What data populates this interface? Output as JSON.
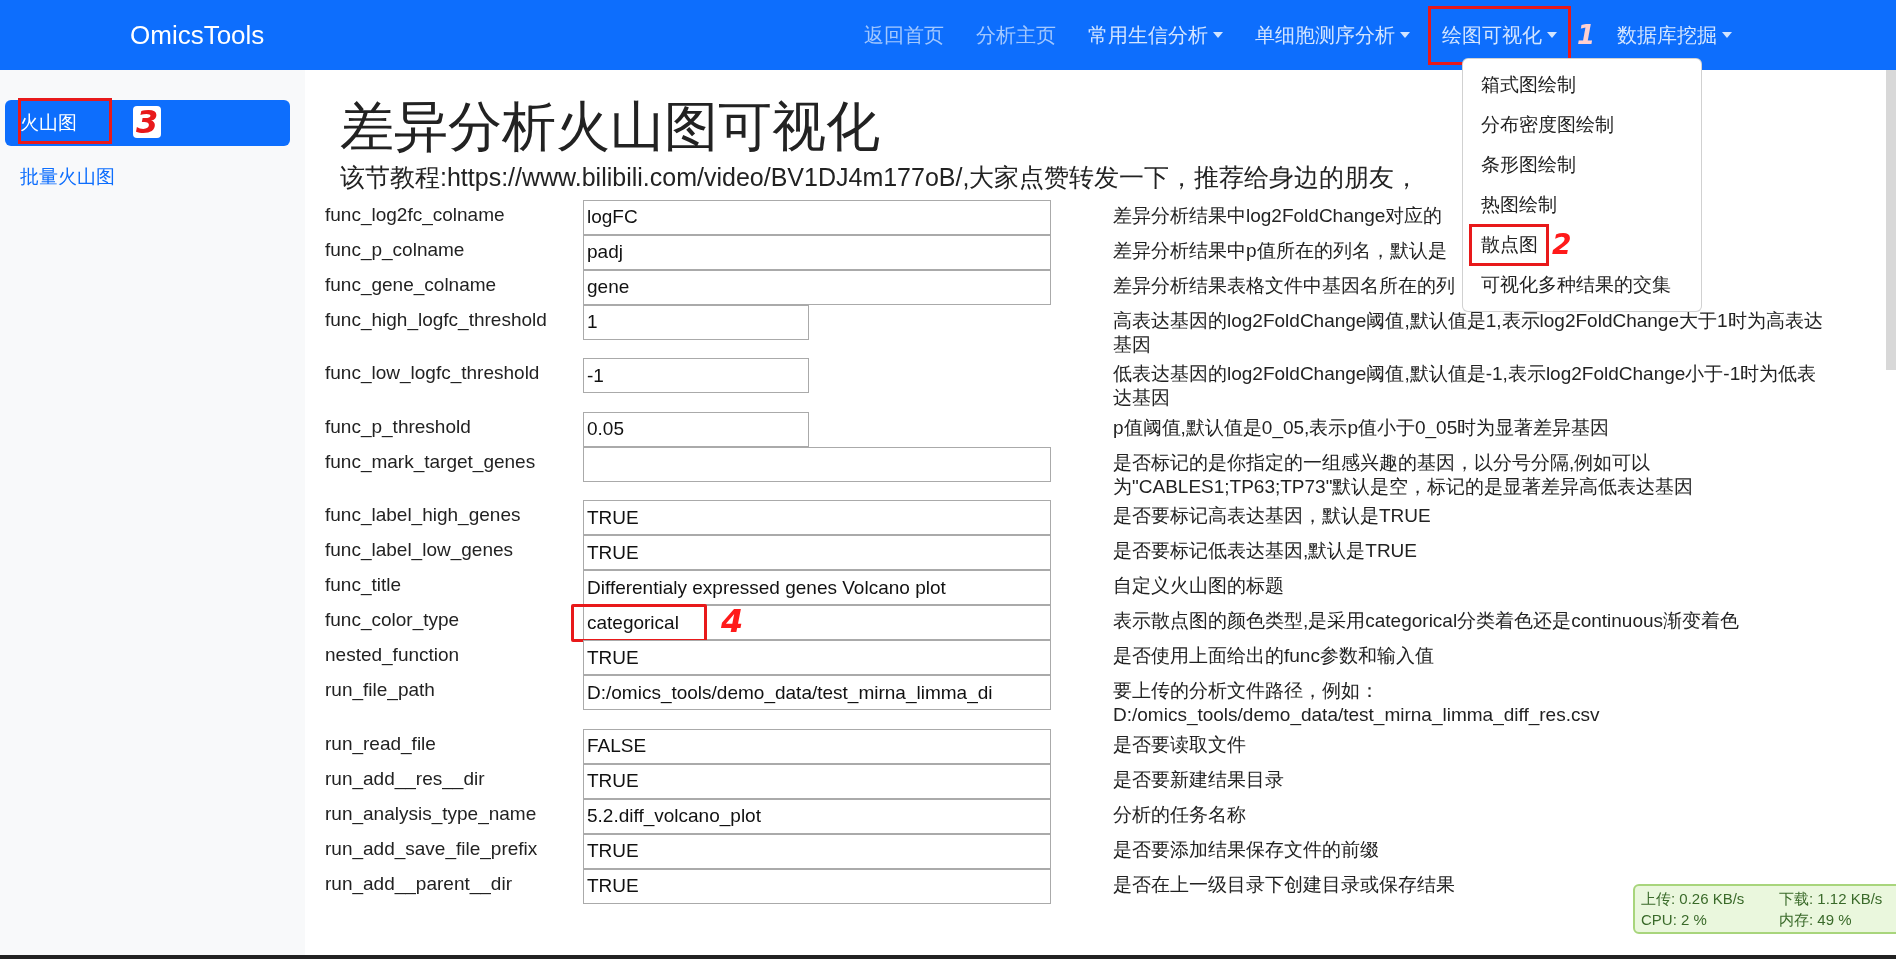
{
  "navbar": {
    "brand": "OmicsTools",
    "items": [
      {
        "label": "返回首页",
        "kind": "link"
      },
      {
        "label": "分析主页",
        "kind": "link"
      },
      {
        "label": "常用生信分析",
        "kind": "dropdown"
      },
      {
        "label": "单细胞测序分析",
        "kind": "dropdown"
      },
      {
        "label": "绘图可视化",
        "kind": "dropdown",
        "annotation": "1"
      },
      {
        "label": "数据库挖掘",
        "kind": "dropdown"
      }
    ]
  },
  "dropdown_menu": {
    "items": [
      {
        "label": "箱式图绘制"
      },
      {
        "label": "分布密度图绘制"
      },
      {
        "label": "条形图绘制"
      },
      {
        "label": "热图绘制"
      },
      {
        "label": "散点图",
        "annotation": "2"
      },
      {
        "label": "可视化多种结果的交集"
      }
    ]
  },
  "sidebar": {
    "items": [
      {
        "label": "火山图",
        "selected": true,
        "annotation": "3"
      },
      {
        "label": "批量火山图",
        "selected": false
      }
    ]
  },
  "page": {
    "title": "差异分析火山图可视化",
    "tutorial": "该节教程:https://www.bilibili.com/video/BV1DJ4m177oB/,大家点赞转发一下，推荐给身边的朋友，"
  },
  "form": {
    "rows": [
      {
        "label": "func_log2fc_colname",
        "value": "logFC",
        "kind": "long",
        "description": "差异分析结果中log2FoldChange对应的"
      },
      {
        "label": "func_p_colname",
        "value": "padj",
        "kind": "long",
        "description": "差异分析结果中p值所在的列名，默认是"
      },
      {
        "label": "func_gene_colname",
        "value": "gene",
        "kind": "long",
        "description": "差异分析结果表格文件中基因名所在的列"
      },
      {
        "label": "func_high_logfc_threshold",
        "value": "1",
        "kind": "short",
        "description": "高表达基因的log2FoldChange阈值,默认值是1,表示log2FoldChange大于1时为高表达基因"
      },
      {
        "label": "func_low_logfc_threshold",
        "value": "-1",
        "kind": "short",
        "description": "低表达基因的log2FoldChange阈值,默认值是-1,表示log2FoldChange小于-1时为低表达基因"
      },
      {
        "label": "func_p_threshold",
        "value": "0.05",
        "kind": "short",
        "description": "p值阈值,默认值是0_05,表示p值小于0_05时为显著差异基因"
      },
      {
        "label": "func_mark_target_genes",
        "kind": "long",
        "description": "是否标记的是你指定的一组感兴趣的基因，以分号分隔,例如可以为\"CABLES1;TP63;TP73\"默认是空，标记的是显著差异高低表达基因"
      },
      {
        "label": "func_label_high_genes",
        "value": "TRUE",
        "kind": "long",
        "description": "是否要标记高表达基因，默认是TRUE"
      },
      {
        "label": "func_label_low_genes",
        "value": "TRUE",
        "kind": "long",
        "description": "是否要标记低表达基因,默认是TRUE"
      },
      {
        "label": "func_title",
        "value": "Differentialy expressed genes Volcano plot",
        "kind": "long",
        "description": "自定义火山图的标题"
      },
      {
        "label": "func_color_type",
        "value": "categorical",
        "kind": "long",
        "description": "表示散点图的颜色类型,是采用categorical分类着色还是continuous渐变着色",
        "annotation": "4"
      },
      {
        "label": "nested_function",
        "value": "TRUE",
        "kind": "long",
        "description": "是否使用上面给出的func参数和输入值"
      },
      {
        "label": "run_file_path",
        "value": "D:/omics_tools/demo_data/test_mirna_limma_di",
        "kind": "long",
        "description": "要上传的分析文件路径，例如：D:/omics_tools/demo_data/test_mirna_limma_diff_res.csv"
      },
      {
        "label": "run_read_file",
        "value": "FALSE",
        "kind": "long",
        "description": "是否要读取文件"
      },
      {
        "label": "run_add__res__dir",
        "value": "TRUE",
        "kind": "long",
        "description": "是否要新建结果目录"
      },
      {
        "label": "run_analysis_type_name",
        "value": "5.2.diff_volcano_plot",
        "kind": "long",
        "description": "分析的任务名称"
      },
      {
        "label": "run_add_save_file_prefix",
        "value": "TRUE",
        "kind": "long",
        "description": "是否要添加结果保存文件的前缀"
      },
      {
        "label": "run_add__parent__dir",
        "value": "TRUE",
        "kind": "long",
        "description": "是否在上一级目录下创建目录或保存结果"
      }
    ]
  },
  "net_monitor": {
    "upload": "上传: 0.26 KB/s",
    "download": "下载: 1.12 KB/s",
    "cpu": "CPU: 2 %",
    "memory": "内存: 49 %"
  }
}
